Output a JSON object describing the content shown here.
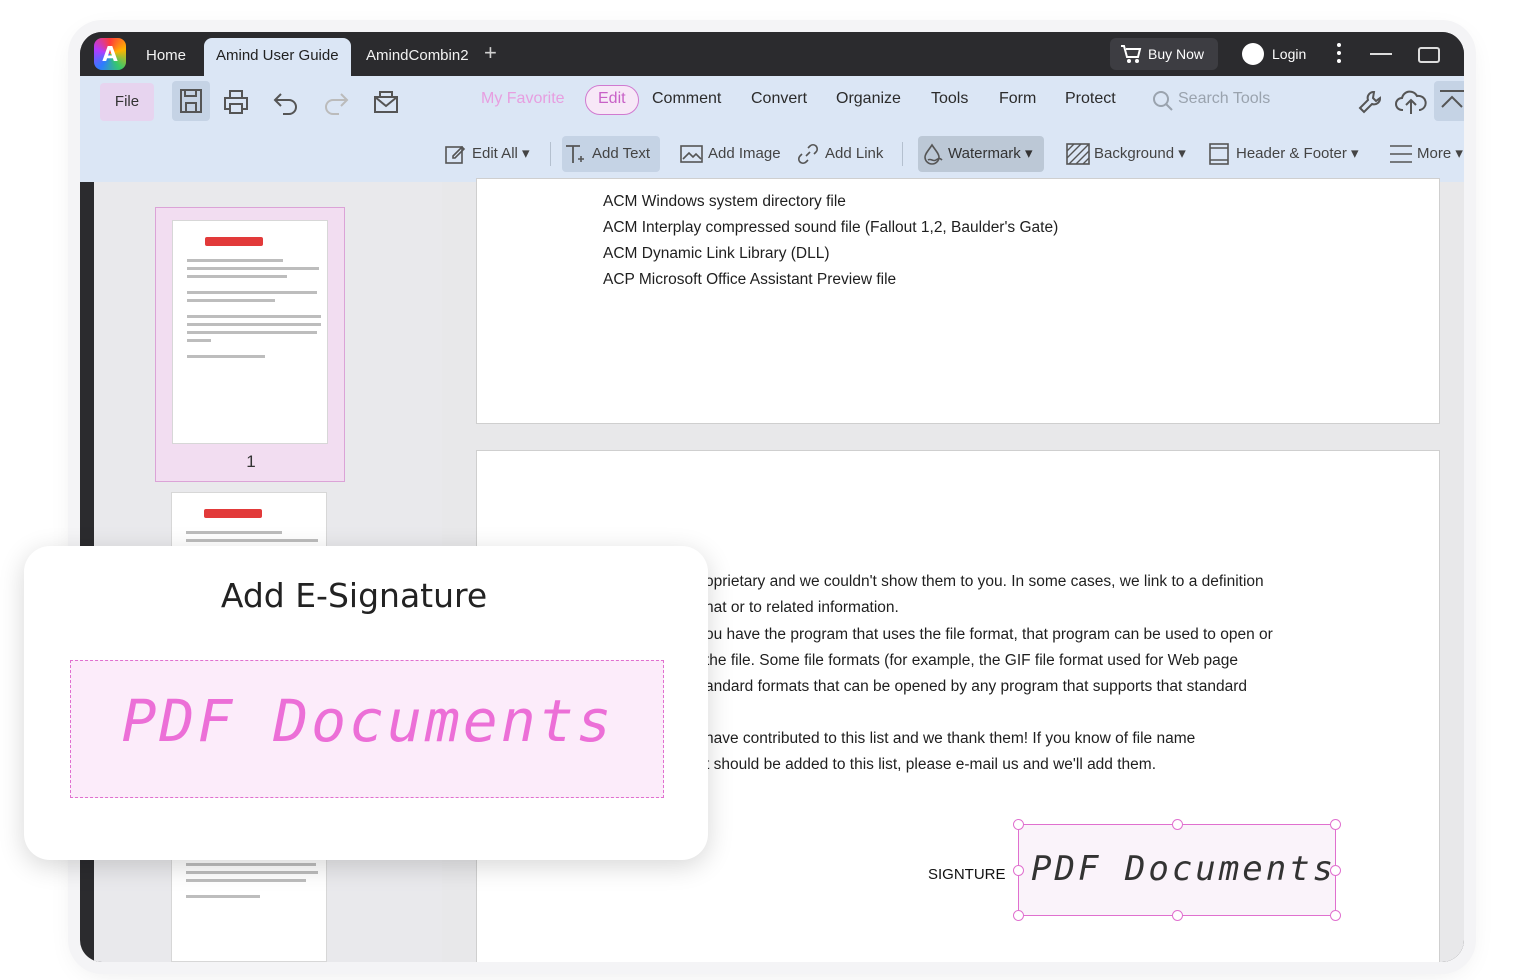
{
  "titlebar": {
    "tabs": [
      "Home",
      "Amind User Guide",
      "AmindCombin2"
    ],
    "buy_now": "Buy Now",
    "login": "Login"
  },
  "toolbar": {
    "file": "File",
    "menus": {
      "my_favorite": "My Favorite",
      "edit": "Edit",
      "comment": "Comment",
      "convert": "Convert",
      "organize": "Organize",
      "tools": "Tools",
      "form": "Form",
      "protect": "Protect"
    },
    "search_tools": "Search Tools",
    "sub": {
      "edit_all": "Edit All ▾",
      "add_text": "Add Text",
      "add_image": "Add Image",
      "add_link": "Add Link",
      "watermark": "Watermark ▾",
      "background": "Background ▾",
      "header_footer": "Header & Footer ▾",
      "more": "More ▾"
    }
  },
  "sidebar": {
    "page_number": "1"
  },
  "document": {
    "page1_lines": [
      "ACM Windows system directory file",
      "ACM Interplay compressed sound file (Fallout 1,2, Baulder's Gate)",
      "ACM Dynamic Link Library (DLL)",
      "ACP Microsoft Office Assistant Preview file"
    ],
    "page2_lines": [
      "oprietary and we couldn't show them to you. In some cases, we link to a definition",
      "hat or to related information.",
      "ou have the program that uses the file format, that program can be used to open or",
      " the file. Some file formats (for example, the GIF file format used for Web page",
      "andard formats that can be opened by any program that supports that standard",
      "",
      " have contributed to this list and we thank them! If you know of file name",
      "t should be added to this list, please e-mail us and we'll add them."
    ],
    "signature_label": "SIGNTURE",
    "signature_text": "PDF Documents"
  },
  "esign_card": {
    "title": "Add E-Signature",
    "signature_text": "PDF Documents"
  },
  "colors": {
    "titlebar": "#2b2b2e",
    "toolbar": "#dbe6f5",
    "accent_pink": "#e070cf"
  }
}
